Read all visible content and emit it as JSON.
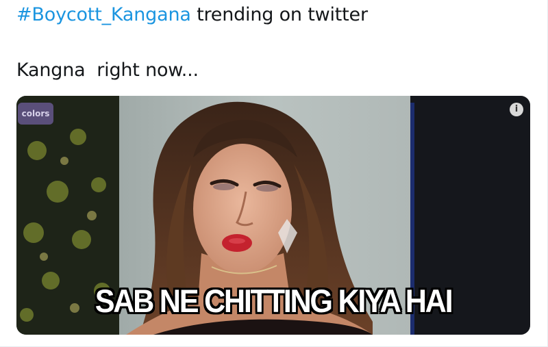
{
  "tweet": {
    "hashtag": "#Boycott_Kangana",
    "line1_rest": " trending on twitter",
    "line2": "Kangna  right now..."
  },
  "media": {
    "caption": "SAB NE CHITTING KIYA HAI",
    "channel_logo": "colors",
    "info_icon": "info-icon",
    "info_glyph": "i"
  },
  "colors": {
    "hashtag": "#1b95e0",
    "text": "#14171a"
  }
}
